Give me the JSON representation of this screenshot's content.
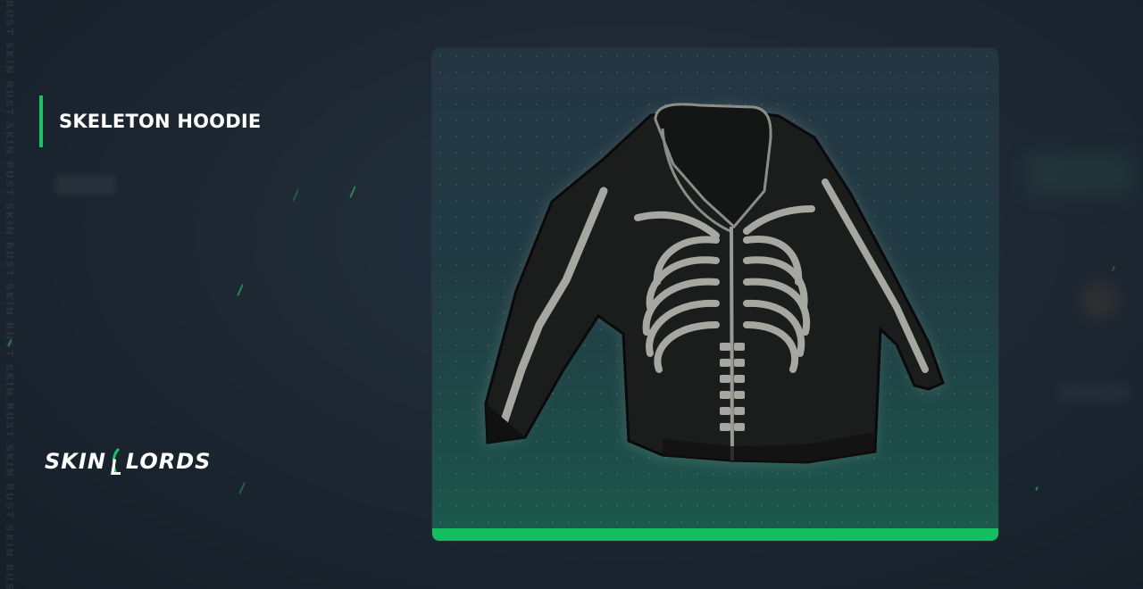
{
  "item": {
    "name": "SKELETON HOODIE"
  },
  "brand": {
    "logo_text": "SKINLORDS",
    "accent_color": "#19c463",
    "watermark": "RUST SKIN RUST SKIN RUST SKIN RUST SKIN RUST SKIN RUST SKIN RUST SKIN RUST SKIN RUST SKIN"
  },
  "preview": {
    "image_subject": "black skeleton print hoodie",
    "bar_color": "#14bd5f"
  },
  "icons": [
    "skinlords-logo-icon"
  ]
}
